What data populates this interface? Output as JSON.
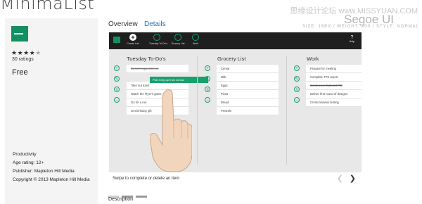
{
  "app": {
    "title": "MinimaList",
    "rating_stars_filled": 4,
    "rating_stars_total": 5,
    "ratings_count": "30 ratings",
    "price": "Free",
    "category": "Productivity",
    "age_rating": "Age rating: 12+",
    "publisher": "Publisher: Mapleton Hill Media",
    "copyright": "Copyright © 2013 Mapleton Hill Media",
    "brand_color": "#129060"
  },
  "watermark": {
    "site": "思缘设计论坛 www.MISSYUAN.COM",
    "font_name": "Segoe UI",
    "font_meta": "SIZE: 16PX / WEIGHT: 400 / STYLE: NORMAL"
  },
  "tabs": [
    {
      "label": "Overview"
    },
    {
      "label": "Details"
    }
  ],
  "screenshot": {
    "toolbar": [
      {
        "label": "Create List",
        "icon": "plus-icon"
      },
      {
        "label": "Tuesday To-Do's",
        "icon": "circle-icon"
      },
      {
        "label": "Grocery List",
        "icon": "circle-icon"
      },
      {
        "label": "Work",
        "icon": "circle-icon"
      }
    ],
    "help": {
      "glyph": "?",
      "label": "Help"
    },
    "lists": [
      {
        "title": "Tuesday To-Do's",
        "items": [
          "Doctor's appointment",
          "",
          "Take out trash",
          "Watch the Flyer's game",
          "Go for a run",
          "Get birthday gift"
        ]
      },
      {
        "title": "Grocery List",
        "items": [
          "Cereal",
          "Milk",
          "Eggs",
          "Pizza",
          "Bread",
          "Pretzels"
        ]
      },
      {
        "title": "Work",
        "items": [
          "Prepare for meeting",
          "Complete TPS report",
          "Conference Call at 2 PM",
          "Deliver first round of designs",
          "Cross-browser testing"
        ]
      }
    ],
    "dragging_item": "Pick Greg up from school",
    "hint": "Swipe to complete or delete an item",
    "nav_prev": "❮",
    "nav_next": "❯"
  },
  "pager": {
    "count": 3,
    "active_index": 0
  },
  "description_label": "Description"
}
